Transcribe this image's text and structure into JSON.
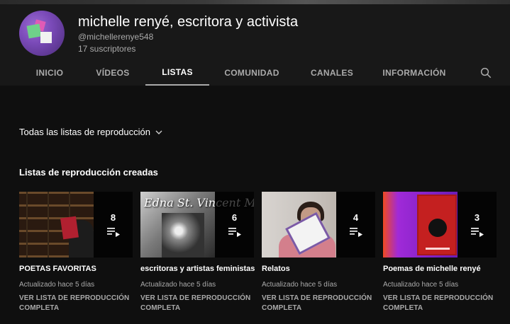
{
  "channel": {
    "name": "michelle renyé, escritora y activista",
    "handle": "@michellerenye548",
    "subscribers": "17 suscriptores"
  },
  "tabs": [
    {
      "label": "INICIO"
    },
    {
      "label": "VÍDEOS"
    },
    {
      "label": "LISTAS",
      "active": true
    },
    {
      "label": "COMUNIDAD"
    },
    {
      "label": "CANALES"
    },
    {
      "label": "INFORMACIÓN"
    }
  ],
  "icons": {
    "search": "search-icon",
    "chevron": "chevron-down-icon",
    "playlist": "playlist-icon"
  },
  "filter": {
    "label": "Todas las listas de reproducción"
  },
  "section": {
    "title": "Listas de reproducción creadas"
  },
  "playlists": [
    {
      "title": "POETAS FAVORITAS",
      "count": "8",
      "updated": "Actualizado hace 5 días",
      "link": "VER LISTA DE REPRODUCCIÓN COMPLETA"
    },
    {
      "title": "escritoras y artistas feministas",
      "count": "6",
      "updated": "Actualizado hace 5 días",
      "link": "VER LISTA DE REPRODUCCIÓN COMPLETA",
      "thumb_text": "Edna St. Vincent Millay"
    },
    {
      "title": "Relatos",
      "count": "4",
      "updated": "Actualizado hace 5 días",
      "link": "VER LISTA DE REPRODUCCIÓN COMPLETA"
    },
    {
      "title": "Poemas de michelle renyé",
      "count": "3",
      "updated": "Actualizado hace 5 días",
      "link": "VER LISTA DE REPRODUCCIÓN COMPLETA"
    }
  ],
  "colors": {
    "background": "#0f0f0f",
    "header": "#181818",
    "muted": "#aaaaaa",
    "text": "#ffffff"
  }
}
